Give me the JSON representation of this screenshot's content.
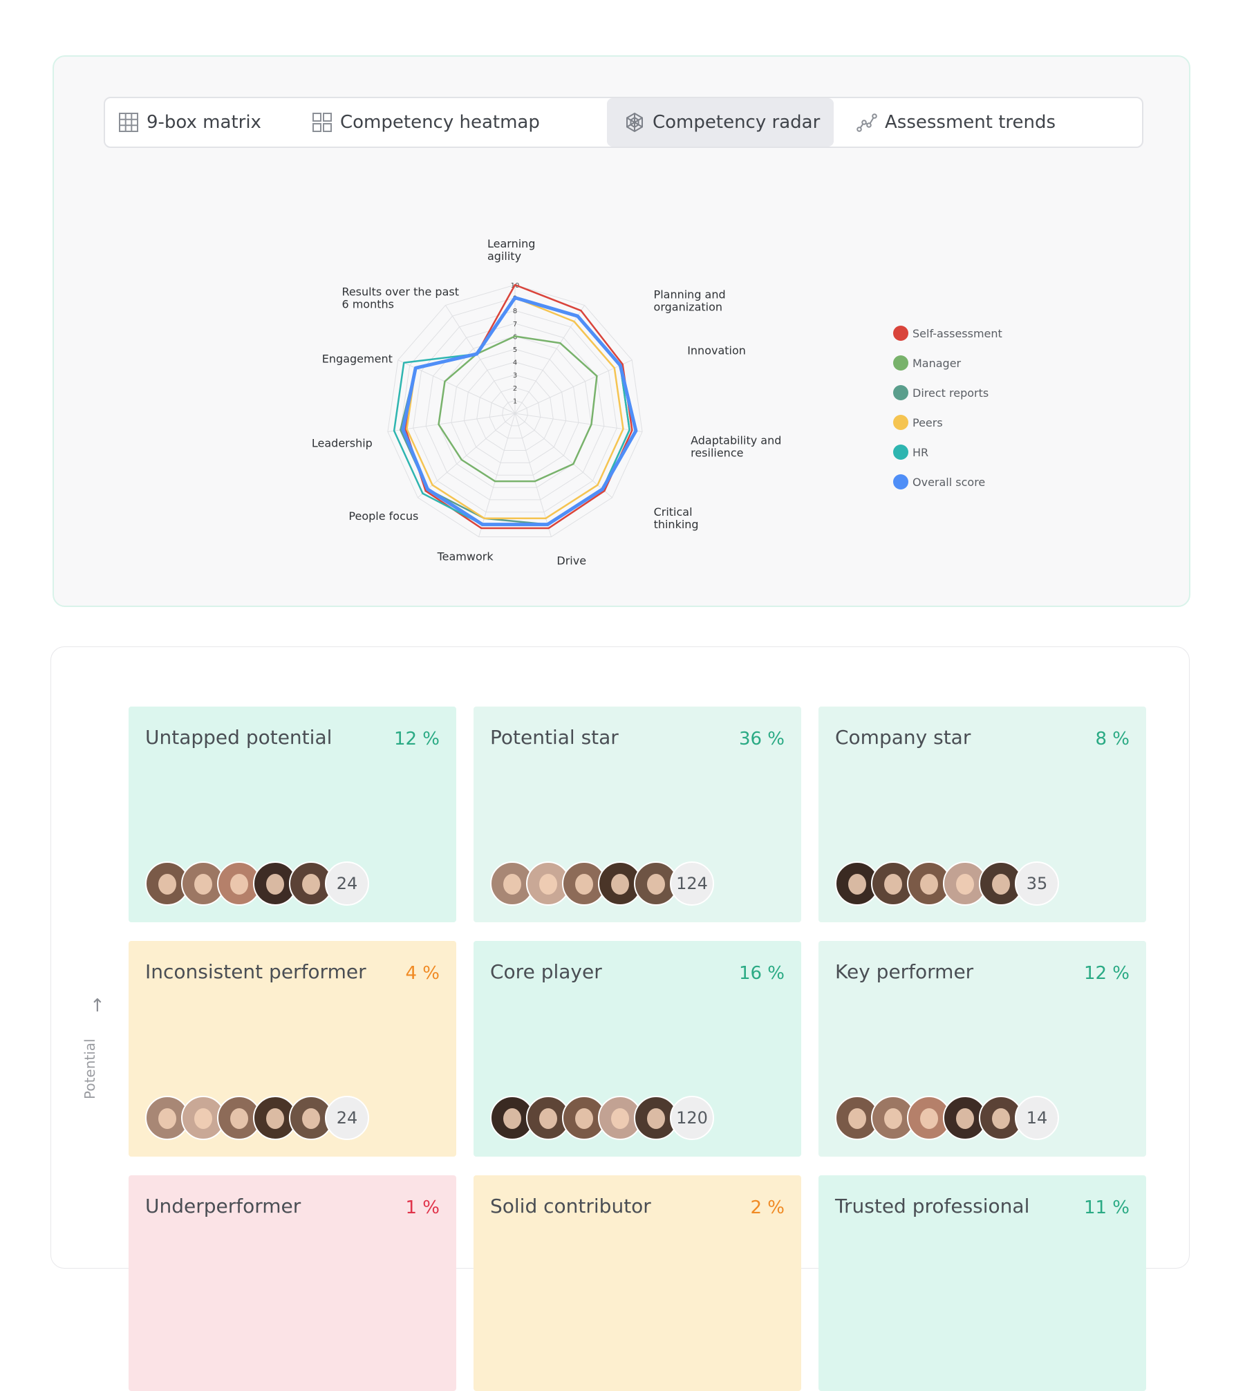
{
  "tabs": [
    {
      "label": "9-box matrix",
      "icon": "grid-icon",
      "active": false
    },
    {
      "label": "Competency heatmap",
      "icon": "squares-icon",
      "active": false
    },
    {
      "label": "Competency radar",
      "icon": "radar-icon",
      "active": true
    },
    {
      "label": "Assessment trends",
      "icon": "trend-icon",
      "active": false
    }
  ],
  "chart_data": {
    "type": "radar",
    "axes": [
      "Learning agility",
      "Planning and organization",
      "Innovation",
      "Adaptability and resilience",
      "Critical thinking",
      "Drive",
      "Teamwork",
      "People focus",
      "Leadership",
      "Engagement",
      "Results over the past 6 months"
    ],
    "axis_label_lines": [
      [
        "Learning",
        "agility"
      ],
      [
        "Planning and",
        "organization"
      ],
      [
        "Innovation"
      ],
      [
        "Adaptability and",
        "resilience"
      ],
      [
        "Critical",
        "thinking"
      ],
      [
        "Drive"
      ],
      [
        "Teamwork"
      ],
      [
        "People focus"
      ],
      [
        "Leadership"
      ],
      [
        "Engagement"
      ],
      [
        "Results over the past",
        "6 months"
      ]
    ],
    "tick_labels": [
      "1",
      "2",
      "3",
      "4",
      "5",
      "6",
      "7",
      "8",
      "9",
      "10"
    ],
    "rlim": [
      0,
      10
    ],
    "series": [
      {
        "name": "Self-assessment",
        "color": "#d9443b",
        "values": [
          10,
          9.5,
          9.2,
          9.2,
          9.2,
          9.3,
          9.3,
          9.2,
          8.6,
          8.5,
          5.5
        ]
      },
      {
        "name": "Manager",
        "color": "#78b26b",
        "values": [
          6,
          6.5,
          7,
          6,
          6,
          5.5,
          5.5,
          5.5,
          6,
          6,
          5.5
        ]
      },
      {
        "name": "Direct reports",
        "color": "#5a9e8c",
        "values": [
          9,
          9,
          9,
          9,
          9,
          9,
          8.5,
          9,
          9,
          8.5,
          5.5
        ]
      },
      {
        "name": "Peers",
        "color": "#f5c451",
        "values": [
          9,
          8.5,
          8.5,
          8.5,
          8.5,
          8.5,
          8.5,
          8.5,
          8.5,
          8.5,
          5.5
        ]
      },
      {
        "name": "HR",
        "color": "#2eb5b0",
        "values": [
          9,
          9,
          9,
          9,
          9,
          9,
          9,
          9.5,
          9.5,
          9.5,
          5.5
        ]
      },
      {
        "name": "Overall score",
        "color": "#4f8ef7",
        "values": [
          9,
          9,
          9,
          9.5,
          9,
          9,
          9,
          9,
          8.8,
          8.5,
          5.5
        ]
      }
    ],
    "legend": "right",
    "grid": true
  },
  "matrix": {
    "axis_label": "Potential",
    "cells": [
      {
        "title": "Untapped potential",
        "pct": "12 %",
        "count": "24",
        "bg": "#dcf6ee",
        "pct_color": "#2aaa84"
      },
      {
        "title": "Potential star",
        "pct": "36 %",
        "count": "124",
        "bg": "#e3f6f0",
        "pct_color": "#2aaa84"
      },
      {
        "title": "Company star",
        "pct": "8 %",
        "count": "35",
        "bg": "#e3f6f0",
        "pct_color": "#2aaa84"
      },
      {
        "title": "Inconsistent performer",
        "pct": "4 %",
        "count": "24",
        "bg": "#fdefcf",
        "pct_color": "#f08a24"
      },
      {
        "title": "Core player",
        "pct": "16 %",
        "count": "120",
        "bg": "#dcf6ee",
        "pct_color": "#2aaa84"
      },
      {
        "title": "Key performer",
        "pct": "12 %",
        "count": "14",
        "bg": "#e3f6f0",
        "pct_color": "#2aaa84"
      },
      {
        "title": "Underperformer",
        "pct": "1 %",
        "count": "",
        "bg": "#fbe3e6",
        "pct_color": "#e0334a"
      },
      {
        "title": "Solid contributor",
        "pct": "2 %",
        "count": "",
        "bg": "#fdefcf",
        "pct_color": "#f08a24"
      },
      {
        "title": "Trusted professional",
        "pct": "11 %",
        "count": "",
        "bg": "#dcf6ee",
        "pct_color": "#2aaa84"
      }
    ]
  }
}
